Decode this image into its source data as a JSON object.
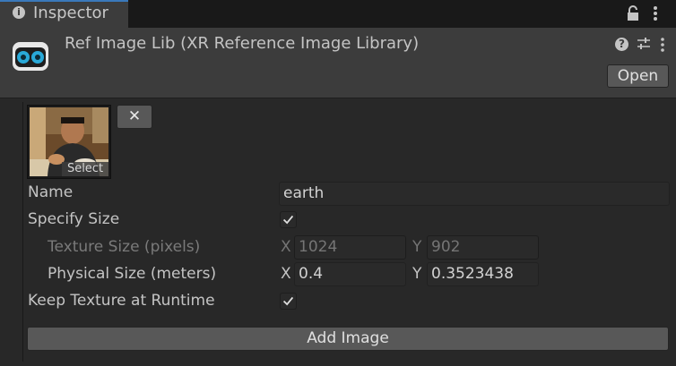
{
  "tab": {
    "title": "Inspector",
    "icon": "info-icon"
  },
  "header": {
    "title": "Ref Image Lib (XR Reference Image Library)",
    "open_label": "Open",
    "icons": [
      "help-icon",
      "preset-icon",
      "kebab-menu-icon"
    ]
  },
  "image_entry": {
    "select_label": "Select",
    "remove_label": "✕"
  },
  "fields": {
    "name_label": "Name",
    "name_value": "earth",
    "specify_size_label": "Specify Size",
    "specify_size_checked": true,
    "texture_size_label": "Texture Size (pixels)",
    "texture_x_label": "X",
    "texture_x": "1024",
    "texture_y_label": "Y",
    "texture_y": "902",
    "physical_size_label": "Physical Size (meters)",
    "physical_x_label": "X",
    "physical_x": "0.4",
    "physical_y_label": "Y",
    "physical_y": "0.3523438",
    "keep_texture_label": "Keep Texture at Runtime",
    "keep_texture_checked": true
  },
  "add_image_label": "Add Image",
  "colors": {
    "accent": "#3a79bb",
    "background": "#282828",
    "header": "#3c3c3c"
  }
}
